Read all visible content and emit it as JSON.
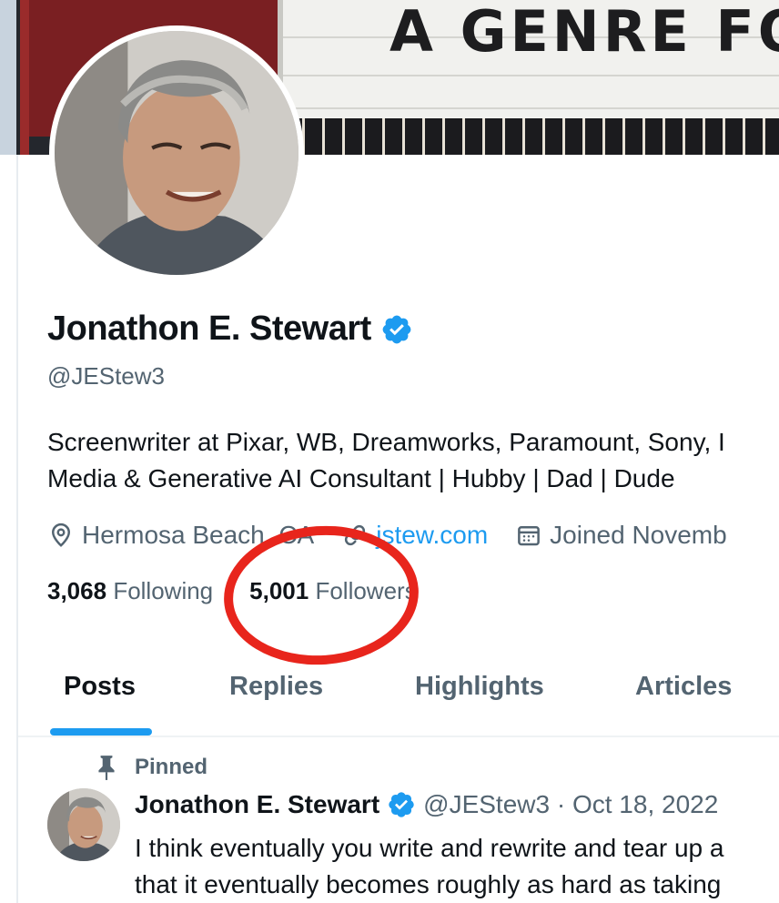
{
  "banner": {
    "marquee_text": "A GENRE FO"
  },
  "profile": {
    "display_name": "Jonathon E. Stewart",
    "handle": "@JEStew3",
    "bio_line1": "Screenwriter at Pixar, WB, Dreamworks, Paramount, Sony, I",
    "bio_line2": "Media & Generative AI Consultant | Hubby | Dad | Dude",
    "location": "Hermosa Beach, CA",
    "website": "jstew.com",
    "joined": "Joined Novemb",
    "following_count": "3,068",
    "following_label": "Following",
    "followers_count": "5,001",
    "followers_label": "Followers",
    "icons": {
      "verified": "verified-badge-icon",
      "location": "location-pin-icon",
      "link": "link-icon",
      "calendar": "calendar-icon"
    },
    "colors": {
      "accent": "#1d9bf0",
      "annotation": "#e8251c",
      "secondary_text": "#536471"
    }
  },
  "tabs": [
    {
      "label": "Posts",
      "active": true
    },
    {
      "label": "Replies",
      "active": false
    },
    {
      "label": "Highlights",
      "active": false
    },
    {
      "label": "Articles",
      "active": false
    }
  ],
  "pinned_post": {
    "pinned_label": "Pinned",
    "author_name": "Jonathon E. Stewart",
    "author_handle_date": "@JEStew3 · Oct 18, 2022",
    "text_line1": "I think eventually you write and rewrite and tear up a",
    "text_line2": "that it eventually becomes roughly as hard as taking"
  }
}
